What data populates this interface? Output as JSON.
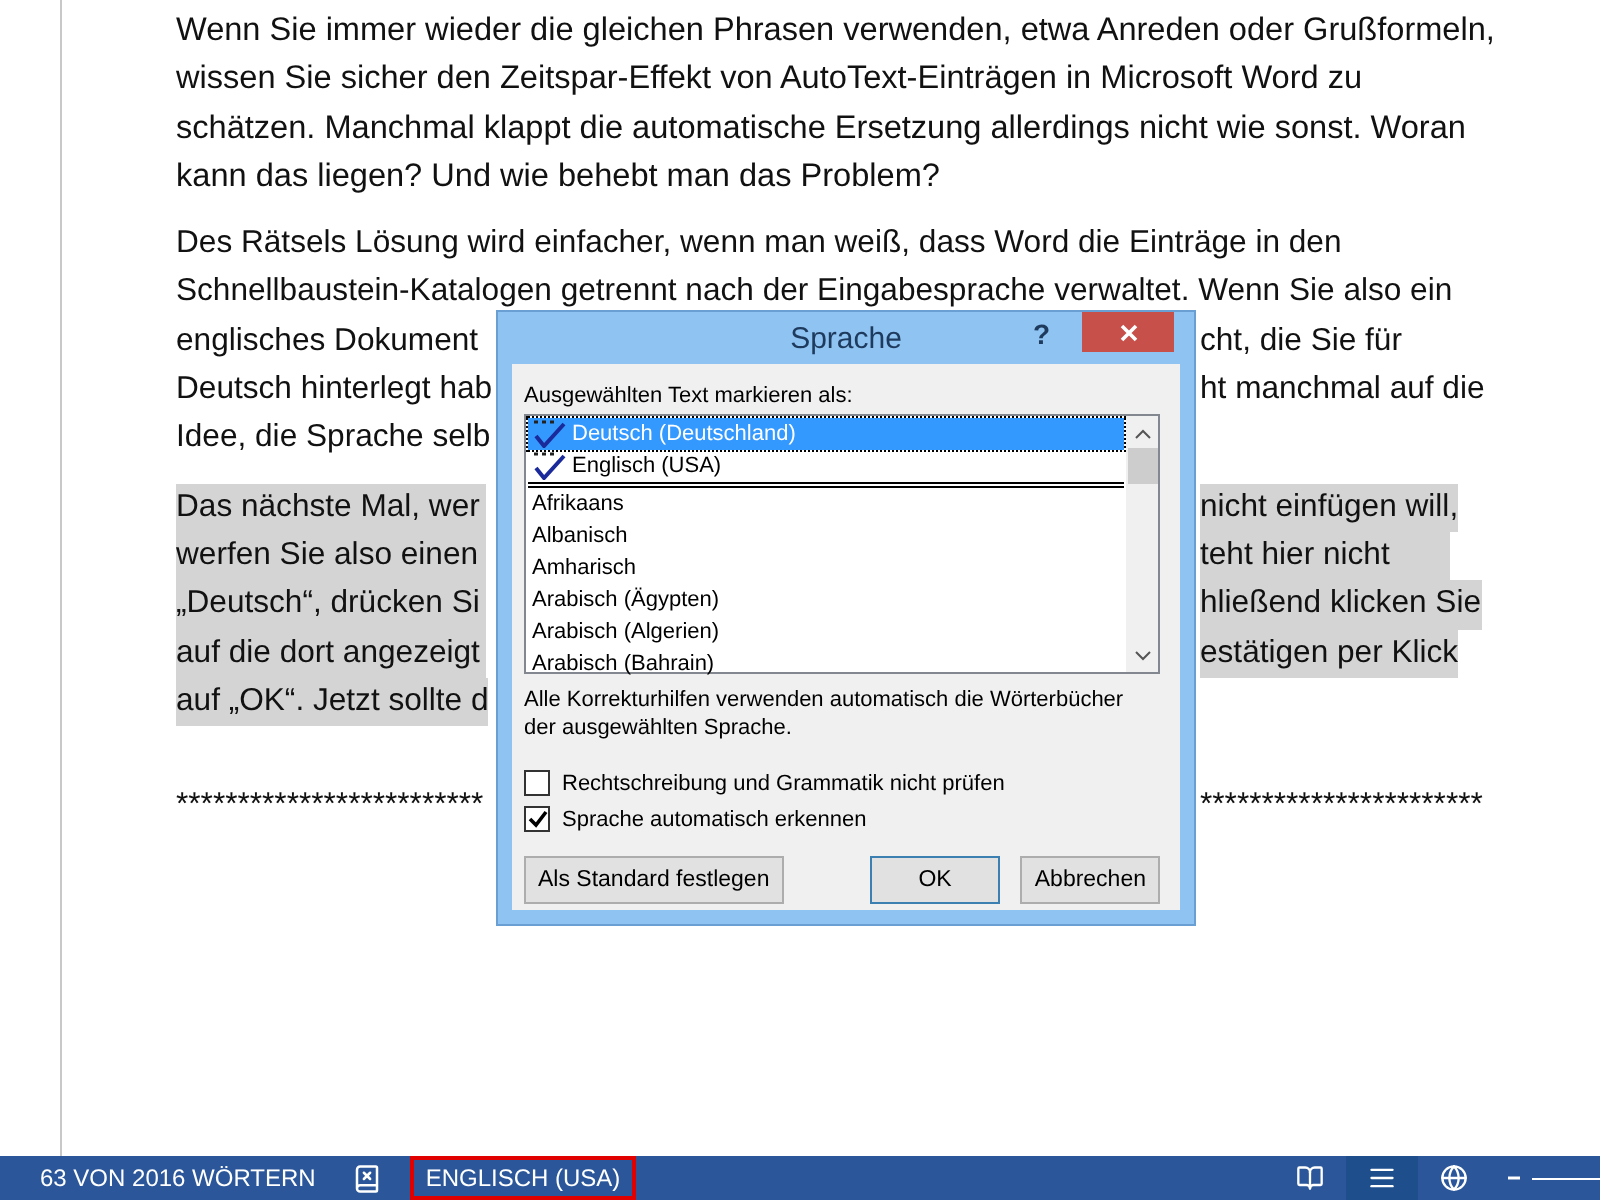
{
  "document": {
    "paragraphs": [
      {
        "highlighted": false,
        "lines": [
          {
            "left": "Wenn Sie immer wieder die gleichen Phrasen verwenden, etwa Anreden oder Grußformeln,"
          },
          {
            "left": "wissen Sie sicher den Zeitspar-Effekt von AutoText-Einträgen in Microsoft Word zu"
          },
          {
            "left": "schätzen. Manchmal klappt die automatische Ersetzung allerdings nicht wie sonst. Woran"
          },
          {
            "left": "kann das liegen? Und wie behebt man das Problem?"
          }
        ]
      },
      {
        "highlighted": false,
        "lines": [
          {
            "left": "Des Rätsels Lösung wird einfacher, wenn man weiß, dass Word die Einträge in den"
          },
          {
            "left": "Schnellbaustein-Katalogen getrennt nach der Eingabesprache verwaltet. Wenn Sie also ein"
          },
          {
            "left": "englisches Dokument",
            "right": "cht, die Sie für"
          },
          {
            "left": "Deutsch hinterlegt hab",
            "right": "ht manchmal auf die"
          },
          {
            "left": "Idee, die Sprache selb"
          }
        ]
      },
      {
        "highlighted": true,
        "lines": [
          {
            "left": "Das nächste Mal, wer",
            "right": "nicht einfügen will,"
          },
          {
            "left": "werfen Sie also einen",
            "right": "teht hier nicht"
          },
          {
            "left": "„Deutsch“, drücken Si",
            "right": "hließend klicken Sie"
          },
          {
            "left": "auf die dort angezeigt",
            "right": "estätigen per Klick"
          },
          {
            "left": "auf „OK“. Jetzt sollte d"
          }
        ]
      },
      {
        "highlighted": false,
        "lines": [
          {
            "left": "*************************",
            "right": "***********************"
          }
        ]
      }
    ]
  },
  "dialog": {
    "title": "Sprache",
    "help": "?",
    "list_label": "Ausgewählten Text markieren als:",
    "languages": [
      {
        "label": "Deutsch (Deutschland)",
        "proofing": true,
        "selected": true
      },
      {
        "label": "Englisch (USA)",
        "proofing": true,
        "selected": false
      },
      {
        "label": "Afrikaans",
        "proofing": false,
        "selected": false
      },
      {
        "label": "Albanisch",
        "proofing": false,
        "selected": false
      },
      {
        "label": "Amharisch",
        "proofing": false,
        "selected": false
      },
      {
        "label": "Arabisch (Ägypten)",
        "proofing": false,
        "selected": false
      },
      {
        "label": "Arabisch (Algerien)",
        "proofing": false,
        "selected": false
      },
      {
        "label": "Arabisch (Bahrain)",
        "proofing": false,
        "selected": false
      }
    ],
    "note": "Alle Korrekturhilfen verwenden automatisch die Wörterbücher der ausgewählten Sprache.",
    "options": [
      {
        "label": "Rechtschreibung und Grammatik nicht prüfen",
        "checked": false
      },
      {
        "label": "Sprache automatisch erkennen",
        "checked": true
      }
    ],
    "buttons": [
      {
        "label": "Als Standard festlegen",
        "default": false
      },
      {
        "label": "OK",
        "default": true
      },
      {
        "label": "Abbrechen",
        "default": false
      }
    ]
  },
  "status_bar": {
    "word_count": "63 VON 2016 WÖRTERN",
    "language": "ENGLISCH (USA)",
    "language_highlighted": true,
    "views": [
      {
        "kind": "read",
        "selected": false
      },
      {
        "kind": "print",
        "selected": true
      },
      {
        "kind": "web",
        "selected": false
      }
    ]
  }
}
